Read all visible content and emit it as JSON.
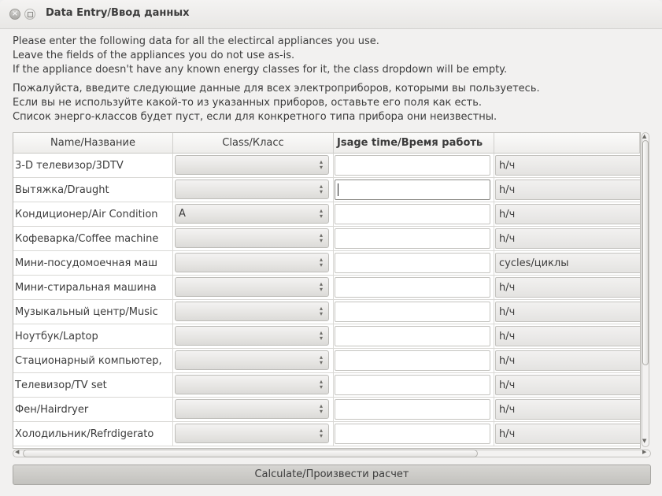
{
  "window": {
    "title": "Data Entry/Ввод данных"
  },
  "instructions": {
    "en": [
      "Please enter the following data for all the electircal appliances you use.",
      "Leave the fields of the appliances you do not use as-is.",
      "If the appliance doesn't have any known energy classes for it, the class dropdown will be empty."
    ],
    "ru": [
      "Пожалуйста, введите следующие данные для всех электроприборов, которыми вы пользуетесь.",
      "Если вы не используйте какой-то из указанных приборов, оставьте его поля как есть.",
      "Список энерго-классов будет пуст, если для конкретного типа прибора они неизвестны."
    ]
  },
  "table": {
    "headers": [
      "Name/Название",
      "Class/Класс",
      "Jsage time/Время работь",
      ""
    ],
    "rows": [
      {
        "name": "3-D телевизор/3DTV",
        "class": "",
        "time": "",
        "unit": "h/ч"
      },
      {
        "name": "Вытяжка/Draught",
        "class": "",
        "time": "",
        "unit": "h/ч"
      },
      {
        "name": "Кондиционер/Air Condition",
        "class": "A",
        "time": "",
        "unit": "h/ч"
      },
      {
        "name": "Кофеварка/Coffee machine",
        "class": "",
        "time": "",
        "unit": "h/ч"
      },
      {
        "name": "Мини-посудомоечная маш",
        "class": "",
        "time": "",
        "unit": "cycles/циклы"
      },
      {
        "name": "Мини-стиральная машина",
        "class": "",
        "time": "",
        "unit": "h/ч"
      },
      {
        "name": "Музыкальный центр/Music",
        "class": "",
        "time": "",
        "unit": "h/ч"
      },
      {
        "name": "Ноутбук/Laptop",
        "class": "",
        "time": "",
        "unit": "h/ч"
      },
      {
        "name": "Стационарный компьютер,",
        "class": "",
        "time": "",
        "unit": "h/ч"
      },
      {
        "name": "Телевизор/TV set",
        "class": "",
        "time": "",
        "unit": "h/ч"
      },
      {
        "name": "Фен/Hairdryer",
        "class": "",
        "time": "",
        "unit": "h/ч"
      },
      {
        "name": "Холодильник/Refrdigerato",
        "class": "",
        "time": "",
        "unit": "h/ч"
      }
    ]
  },
  "button": {
    "calculate_label": "Calculate/Произвести расчет"
  },
  "colors": {
    "window_bg": "#f2f1f0",
    "button_bg": "#c9c8c5"
  }
}
